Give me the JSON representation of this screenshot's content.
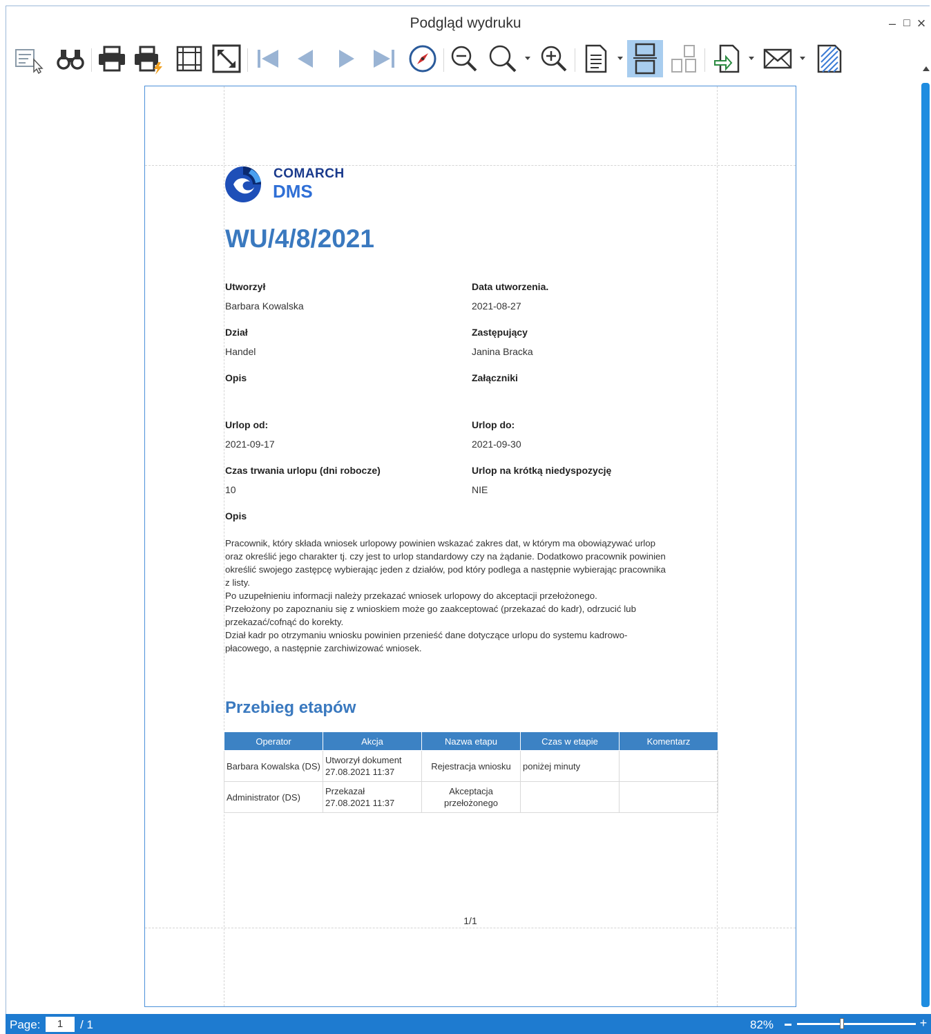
{
  "window": {
    "title": "Podgląd wydruku",
    "minimize_glyph": "–",
    "maximize_glyph": "□",
    "close_glyph": "×"
  },
  "toolbar": {
    "buttons": [
      {
        "name": "parameters-icon"
      },
      {
        "name": "find-icon"
      },
      {
        "name": "print-icon"
      },
      {
        "name": "quick-print-icon"
      },
      {
        "name": "page-setup-icon"
      },
      {
        "name": "scale-icon"
      },
      {
        "name": "first-page-icon"
      },
      {
        "name": "previous-page-icon"
      },
      {
        "name": "next-page-icon"
      },
      {
        "name": "last-page-icon"
      },
      {
        "name": "navigation-icon"
      },
      {
        "name": "zoom-out-icon"
      },
      {
        "name": "zoom-icon"
      },
      {
        "name": "zoom-in-icon"
      },
      {
        "name": "single-page-icon"
      },
      {
        "name": "continuous-view-icon",
        "active": true
      },
      {
        "name": "multi-page-icon"
      },
      {
        "name": "export-icon"
      },
      {
        "name": "email-icon"
      },
      {
        "name": "watermark-icon"
      }
    ]
  },
  "document": {
    "logo": {
      "line1": "COMARCH",
      "line2": "DMS"
    },
    "title": "WU/4/8/2021",
    "fields": {
      "created_by_label": "Utworzył",
      "created_by_value": "Barbara Kowalska",
      "created_date_label": "Data utworzenia.",
      "created_date_value": "2021-08-27",
      "department_label": "Dział",
      "department_value": "Handel",
      "substitute_label": "Zastępujący",
      "substitute_value": "Janina Bracka",
      "description_label": "Opis",
      "attachments_label": "Załączniki",
      "leave_from_label": "Urlop od:",
      "leave_from_value": "2021-09-17",
      "leave_to_label": "Urlop do:",
      "leave_to_value": "2021-09-30",
      "duration_label": "Czas trwania urlopu (dni robocze)",
      "duration_value": "10",
      "short_illness_label": "Urlop na krótką niedyspozycję",
      "short_illness_value": "NIE",
      "description2_label": "Opis"
    },
    "description_lines": [
      "Pracownik, który składa wniosek urlopowy powinien wskazać zakres dat, w którym ma obowiązywać urlop",
      "oraz określić jego charakter tj. czy jest to urlop standardowy czy na żądanie. Dodatkowo pracownik powinien",
      "określić swojego zastępcę wybierając jeden z działów, pod który podlega a następnie wybierając pracownika",
      "z listy.",
      "Po uzupełnieniu informacji należy przekazać wniosek urlopowy do akceptacji przełożonego.",
      "Przełożony po zapoznaniu się z wnioskiem może go zaakceptować (przekazać do kadr), odrzucić lub",
      "przekazać/cofnąć do korekty.",
      "Dział kadr po otrzymaniu wniosku powinien przenieść dane dotyczące urlopu do systemu kadrowo-",
      "płacowego, a następnie zarchiwizować wniosek."
    ],
    "stages_title": "Przebieg etapów",
    "stages_table": {
      "headers": [
        "Operator",
        "Akcja",
        "Nazwa etapu",
        "Czas w etapie",
        "Komentarz"
      ],
      "rows": [
        {
          "operator": "Barbara Kowalska (DS)",
          "action_line1": "Utworzył dokument",
          "action_line2": "27.08.2021 11:37",
          "stage_line1": "Rejestracja wniosku",
          "stage_line2": "",
          "time": "poniżej minuty",
          "comment": ""
        },
        {
          "operator": "Administrator (DS)",
          "action_line1": "Przekazał",
          "action_line2": "27.08.2021 11:37",
          "stage_line1": "Akceptacja",
          "stage_line2": "przełożonego",
          "time": "",
          "comment": ""
        }
      ]
    },
    "page_number": "1/1"
  },
  "statusbar": {
    "page_label": "Page:",
    "current_page": "1",
    "total_pages": "/ 1",
    "zoom_text": "82%",
    "zoom_percent": 82
  },
  "colors": {
    "accent": "#3a79bf",
    "table_header": "#3c82c4",
    "statusbar": "#1e7bd0",
    "active_button": "#a8cdef"
  }
}
